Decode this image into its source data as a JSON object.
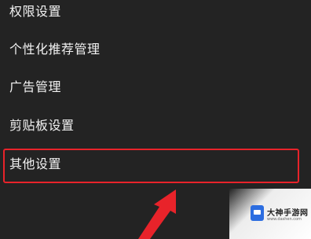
{
  "settings": {
    "items": [
      {
        "label": "权限设置"
      },
      {
        "label": "个性化推荐管理"
      },
      {
        "label": "广告管理"
      },
      {
        "label": "剪贴板设置"
      },
      {
        "label": "其他设置"
      }
    ]
  },
  "colors": {
    "background": "#232323",
    "highlight": "#e8232a",
    "arrow": "#e8232a"
  },
  "watermark": {
    "text": "大神手游网",
    "url": "www.dashen.com"
  }
}
